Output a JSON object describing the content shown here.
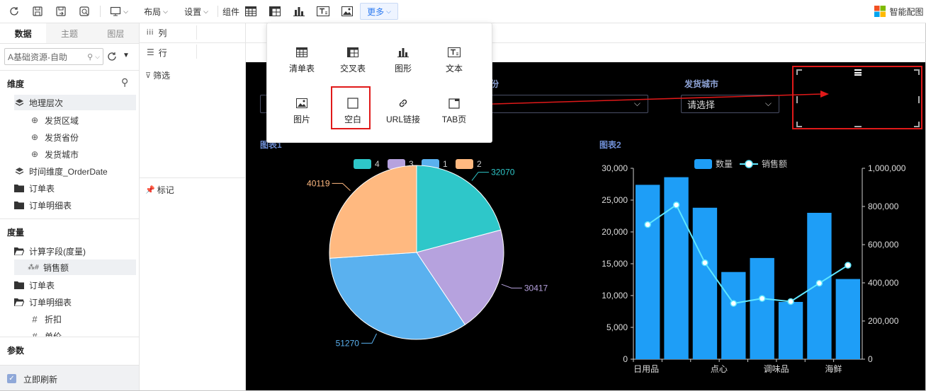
{
  "toolbar": {
    "layout_label": "布局",
    "settings_label": "设置",
    "component_label": "组件",
    "more_label": "更多",
    "brand_label": "智能配图"
  },
  "left_panel": {
    "tabs": [
      "数据",
      "主题",
      "图层"
    ],
    "datasource": "A基础资源-自助",
    "dimension_title": "维度",
    "dimensions": [
      "地理层次",
      "发货区域",
      "发货省份",
      "发货城市",
      "时间维度_OrderDate",
      "订单表",
      "订单明细表"
    ],
    "measure_title": "度量",
    "measures": [
      "计算字段(度量)",
      "销售额",
      "订单表",
      "订单明细表",
      "折扣",
      "单价"
    ],
    "param_title": "参数",
    "auto_refresh": "立即刷新"
  },
  "mid_panel": {
    "columns_label": "列",
    "rows_label": "行",
    "filter_label": "筛选",
    "mark_label": "标记"
  },
  "popup": {
    "items": [
      "清单表",
      "交叉表",
      "图形",
      "文本",
      "图片",
      "空白",
      "URL链接",
      "TAB页"
    ]
  },
  "canvas": {
    "filter1_label": "份",
    "filter2_label": "发货城市",
    "select_placeholder": "请选择",
    "chart1_title": "图表1",
    "chart2_title": "图表2"
  },
  "colors": {
    "pie_4": "#2ec7c9",
    "pie_3": "#b6a2de",
    "pie_1": "#5ab1ef",
    "pie_2": "#ffb980",
    "bar": "#1e9ef7",
    "line": "#5ee6ff",
    "highlight_red": "#e01919"
  },
  "chart_data": [
    {
      "type": "pie",
      "title": "图表1",
      "legend": [
        "4",
        "3",
        "1",
        "2"
      ],
      "values": [
        32070,
        30417,
        51270,
        40119
      ],
      "labels": [
        "32070",
        "30417",
        "51270",
        "40119"
      ]
    },
    {
      "type": "bar",
      "title": "图表2",
      "categories": [
        "日用品",
        "",
        "点心",
        "",
        "调味品",
        "",
        "海鲜",
        ""
      ],
      "series": [
        {
          "name": "数量",
          "type": "bar",
          "axis": "left",
          "values": [
            27400,
            28600,
            23800,
            13700,
            15900,
            9000,
            23000,
            12600
          ]
        },
        {
          "name": "销售额",
          "type": "line",
          "axis": "right",
          "values": [
            705000,
            808000,
            505000,
            292000,
            318000,
            302000,
            398000,
            492000
          ]
        }
      ],
      "ylim_left": [
        0,
        30000
      ],
      "yticks_left": [
        "0",
        "5,000",
        "10,000",
        "15,000",
        "20,000",
        "25,000",
        "30,000"
      ],
      "ylim_right": [
        0,
        1000000
      ],
      "yticks_right": [
        "0",
        "200,000",
        "400,000",
        "600,000",
        "800,000",
        "1,000,000"
      ]
    }
  ]
}
